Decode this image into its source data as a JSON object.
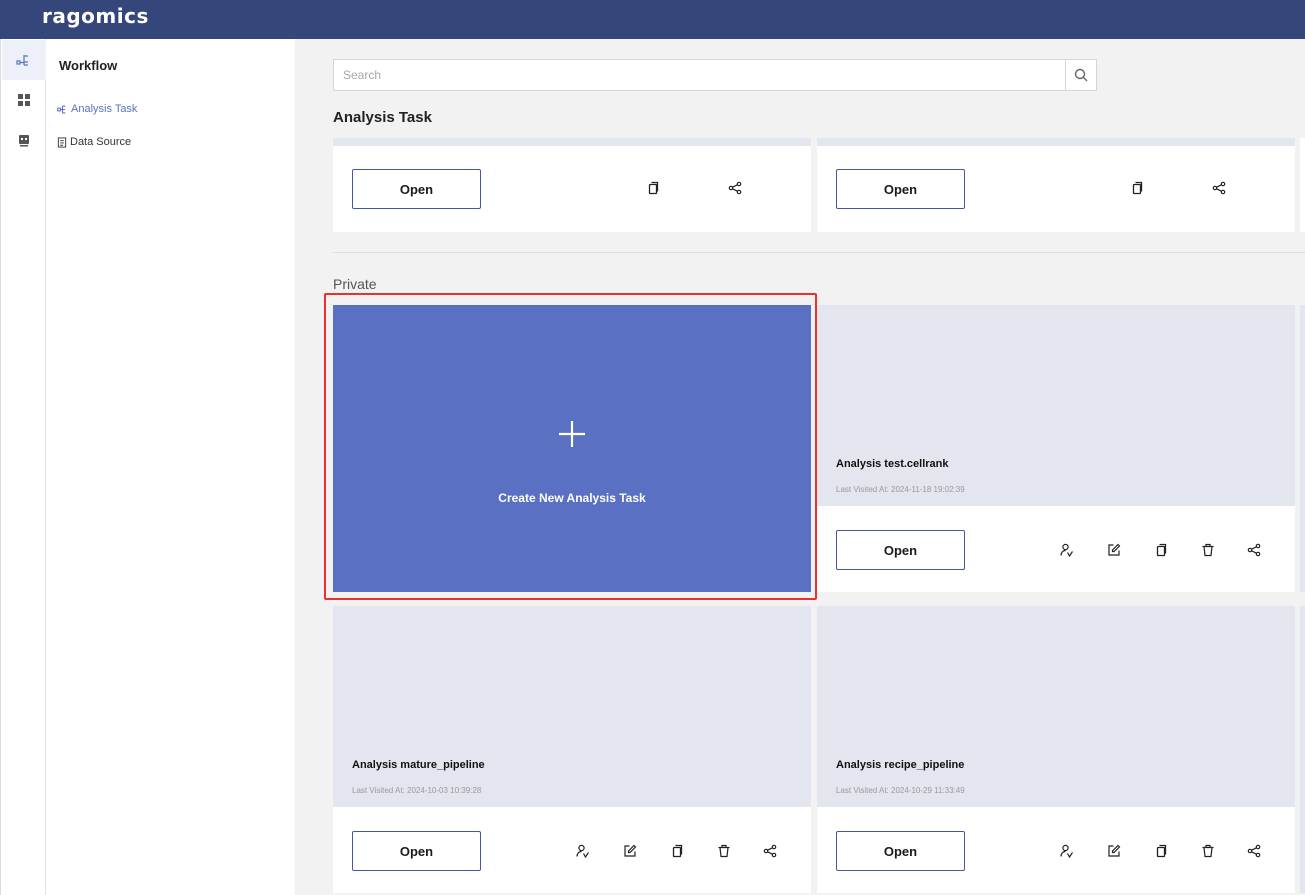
{
  "app": {
    "logo": "ragomics"
  },
  "rail": {
    "items": [
      {
        "icon": "workflow-icon",
        "active": true
      },
      {
        "icon": "grid-icon",
        "active": false
      },
      {
        "icon": "robot-icon",
        "active": false
      }
    ]
  },
  "sidebar": {
    "title": "Workflow",
    "items": [
      {
        "label": "Analysis Task",
        "icon": "workflow-small-icon",
        "active": true
      },
      {
        "label": "Data Source",
        "icon": "document-icon",
        "active": false
      }
    ]
  },
  "search": {
    "placeholder": "Search",
    "value": ""
  },
  "main": {
    "section_title": "Analysis Task",
    "private_label": "Private",
    "create_label": "Create New Analysis Task",
    "open_label": "Open",
    "cards": [
      {
        "name": "Analysis test.cellrank",
        "last_visited": "Last Visited At: 2024-11-18 19:02:39"
      },
      {
        "name": "Analysis mature_pipeline",
        "last_visited": "Last Visited At: 2024-10-03 10:39:28"
      },
      {
        "name": "Analysis recipe_pipeline",
        "last_visited": "Last Visited At: 2024-10-29 11:33:49"
      }
    ]
  },
  "colors": {
    "topbar": "#35477a",
    "accent": "#5a70c2",
    "highlight": "#e8322b"
  }
}
